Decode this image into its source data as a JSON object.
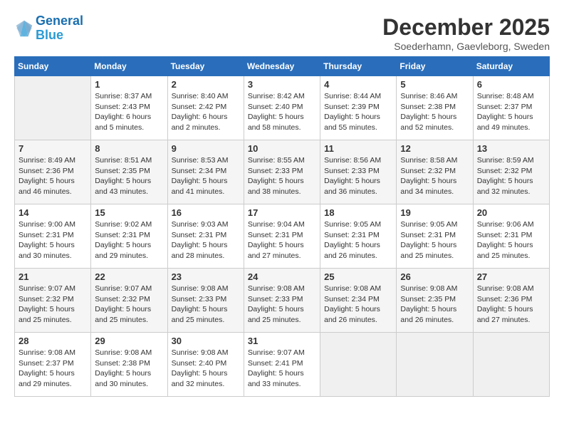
{
  "logo": {
    "line1": "General",
    "line2": "Blue"
  },
  "title": "December 2025",
  "subtitle": "Soederhamn, Gaevleborg, Sweden",
  "weekdays": [
    "Sunday",
    "Monday",
    "Tuesday",
    "Wednesday",
    "Thursday",
    "Friday",
    "Saturday"
  ],
  "weeks": [
    [
      {
        "day": "",
        "info": ""
      },
      {
        "day": "1",
        "info": "Sunrise: 8:37 AM\nSunset: 2:43 PM\nDaylight: 6 hours\nand 5 minutes."
      },
      {
        "day": "2",
        "info": "Sunrise: 8:40 AM\nSunset: 2:42 PM\nDaylight: 6 hours\nand 2 minutes."
      },
      {
        "day": "3",
        "info": "Sunrise: 8:42 AM\nSunset: 2:40 PM\nDaylight: 5 hours\nand 58 minutes."
      },
      {
        "day": "4",
        "info": "Sunrise: 8:44 AM\nSunset: 2:39 PM\nDaylight: 5 hours\nand 55 minutes."
      },
      {
        "day": "5",
        "info": "Sunrise: 8:46 AM\nSunset: 2:38 PM\nDaylight: 5 hours\nand 52 minutes."
      },
      {
        "day": "6",
        "info": "Sunrise: 8:48 AM\nSunset: 2:37 PM\nDaylight: 5 hours\nand 49 minutes."
      }
    ],
    [
      {
        "day": "7",
        "info": "Sunrise: 8:49 AM\nSunset: 2:36 PM\nDaylight: 5 hours\nand 46 minutes."
      },
      {
        "day": "8",
        "info": "Sunrise: 8:51 AM\nSunset: 2:35 PM\nDaylight: 5 hours\nand 43 minutes."
      },
      {
        "day": "9",
        "info": "Sunrise: 8:53 AM\nSunset: 2:34 PM\nDaylight: 5 hours\nand 41 minutes."
      },
      {
        "day": "10",
        "info": "Sunrise: 8:55 AM\nSunset: 2:33 PM\nDaylight: 5 hours\nand 38 minutes."
      },
      {
        "day": "11",
        "info": "Sunrise: 8:56 AM\nSunset: 2:33 PM\nDaylight: 5 hours\nand 36 minutes."
      },
      {
        "day": "12",
        "info": "Sunrise: 8:58 AM\nSunset: 2:32 PM\nDaylight: 5 hours\nand 34 minutes."
      },
      {
        "day": "13",
        "info": "Sunrise: 8:59 AM\nSunset: 2:32 PM\nDaylight: 5 hours\nand 32 minutes."
      }
    ],
    [
      {
        "day": "14",
        "info": "Sunrise: 9:00 AM\nSunset: 2:31 PM\nDaylight: 5 hours\nand 30 minutes."
      },
      {
        "day": "15",
        "info": "Sunrise: 9:02 AM\nSunset: 2:31 PM\nDaylight: 5 hours\nand 29 minutes."
      },
      {
        "day": "16",
        "info": "Sunrise: 9:03 AM\nSunset: 2:31 PM\nDaylight: 5 hours\nand 28 minutes."
      },
      {
        "day": "17",
        "info": "Sunrise: 9:04 AM\nSunset: 2:31 PM\nDaylight: 5 hours\nand 27 minutes."
      },
      {
        "day": "18",
        "info": "Sunrise: 9:05 AM\nSunset: 2:31 PM\nDaylight: 5 hours\nand 26 minutes."
      },
      {
        "day": "19",
        "info": "Sunrise: 9:05 AM\nSunset: 2:31 PM\nDaylight: 5 hours\nand 25 minutes."
      },
      {
        "day": "20",
        "info": "Sunrise: 9:06 AM\nSunset: 2:31 PM\nDaylight: 5 hours\nand 25 minutes."
      }
    ],
    [
      {
        "day": "21",
        "info": "Sunrise: 9:07 AM\nSunset: 2:32 PM\nDaylight: 5 hours\nand 25 minutes."
      },
      {
        "day": "22",
        "info": "Sunrise: 9:07 AM\nSunset: 2:32 PM\nDaylight: 5 hours\nand 25 minutes."
      },
      {
        "day": "23",
        "info": "Sunrise: 9:08 AM\nSunset: 2:33 PM\nDaylight: 5 hours\nand 25 minutes."
      },
      {
        "day": "24",
        "info": "Sunrise: 9:08 AM\nSunset: 2:33 PM\nDaylight: 5 hours\nand 25 minutes."
      },
      {
        "day": "25",
        "info": "Sunrise: 9:08 AM\nSunset: 2:34 PM\nDaylight: 5 hours\nand 26 minutes."
      },
      {
        "day": "26",
        "info": "Sunrise: 9:08 AM\nSunset: 2:35 PM\nDaylight: 5 hours\nand 26 minutes."
      },
      {
        "day": "27",
        "info": "Sunrise: 9:08 AM\nSunset: 2:36 PM\nDaylight: 5 hours\nand 27 minutes."
      }
    ],
    [
      {
        "day": "28",
        "info": "Sunrise: 9:08 AM\nSunset: 2:37 PM\nDaylight: 5 hours\nand 29 minutes."
      },
      {
        "day": "29",
        "info": "Sunrise: 9:08 AM\nSunset: 2:38 PM\nDaylight: 5 hours\nand 30 minutes."
      },
      {
        "day": "30",
        "info": "Sunrise: 9:08 AM\nSunset: 2:40 PM\nDaylight: 5 hours\nand 32 minutes."
      },
      {
        "day": "31",
        "info": "Sunrise: 9:07 AM\nSunset: 2:41 PM\nDaylight: 5 hours\nand 33 minutes."
      },
      {
        "day": "",
        "info": ""
      },
      {
        "day": "",
        "info": ""
      },
      {
        "day": "",
        "info": ""
      }
    ]
  ]
}
